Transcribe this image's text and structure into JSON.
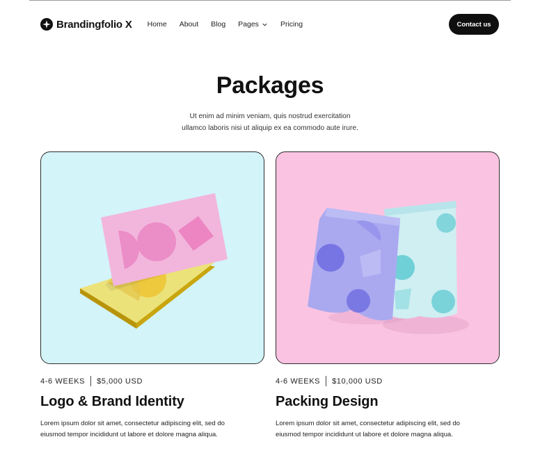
{
  "nav": {
    "brand": "Brandingfolio X",
    "links": [
      "Home",
      "About",
      "Blog",
      "Pages",
      "Pricing"
    ],
    "contact": "Contact us"
  },
  "hero": {
    "title": "Packages",
    "subtitle_line1": "Ut enim ad minim veniam, quis nostrud exercitation",
    "subtitle_line2": "ullamco laboris nisi ut aliquip ex ea commodo aute irure."
  },
  "packages": [
    {
      "duration": "4-6 WEEKS",
      "price": "$5,000 USD",
      "title": "Logo & Brand Identity",
      "desc_line1": "Lorem ipsum dolor sit amet, consectetur adipiscing elit, sed do",
      "desc_line2": "eiusmod tempor incididunt ut labore et dolore magna aliqua.",
      "image": "business-cards-mockup",
      "bg_color": "#d3f4f9"
    },
    {
      "duration": "4-6 WEEKS",
      "price": "$10,000 USD",
      "title": "Packing Design",
      "desc_line1": "Lorem ipsum dolor sit amet, consectetur adipiscing elit, sed do",
      "desc_line2": "eiusmod tempor incididunt ut labore et dolore magna aliqua.",
      "image": "pouch-packaging-mockup",
      "bg_color": "#fbc3e2"
    }
  ]
}
